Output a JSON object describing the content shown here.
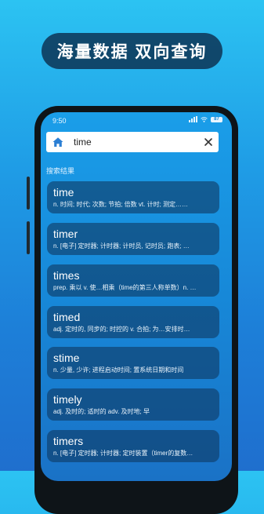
{
  "headline": "海量数据  双向查询",
  "status_bar": {
    "time": "9:50",
    "battery": "87"
  },
  "search": {
    "value": "time"
  },
  "section_label": "搜索结果",
  "results": [
    {
      "word": "time",
      "definition": "n. 时间; 时代; 次数; 节拍; 倍数 vt. 计时; 测定……"
    },
    {
      "word": "timer",
      "definition": "n. [电子] 定时器; 计时器; 计时员, 记时员; 跑表; …"
    },
    {
      "word": "times",
      "definition": "prep. 乘以 v. 使…相乘（time的第三人称单数）n. …"
    },
    {
      "word": "timed",
      "definition": "adj. 定时的, 同步的; 时控的 v. 合拍; 为…安排时…"
    },
    {
      "word": "stime",
      "definition": "n. 少量, 少许; 进程启动时间; 置系统日期和时间"
    },
    {
      "word": "timely",
      "definition": "adj. 及时的; 适时的 adv. 及时地; 早"
    },
    {
      "word": "timers",
      "definition": "n. [电子] 定时器; 计时器; 定时装置（timer的复数…"
    }
  ]
}
